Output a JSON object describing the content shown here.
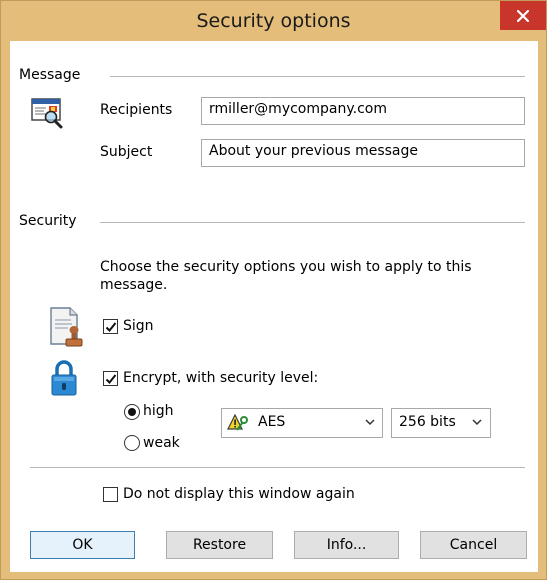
{
  "window": {
    "title": "Security options"
  },
  "message_group": {
    "label": "Message",
    "recipients_label": "Recipients",
    "recipients_value": "rmiller@mycompany.com",
    "subject_label": "Subject",
    "subject_value": "About your previous message"
  },
  "security_group": {
    "label": "Security",
    "description_line1": "Choose the security options you wish to apply to this",
    "description_line2": "message.",
    "sign_label": "Sign",
    "sign_checked": true,
    "encrypt_label": "Encrypt, with security level:",
    "encrypt_checked": true,
    "level_high": "high",
    "level_weak": "weak",
    "selected_level": "high",
    "algorithm_value": "AES",
    "keysize_value": "256 bits"
  },
  "dont_show_label": "Do not display this window again",
  "buttons": {
    "ok": "OK",
    "restore": "Restore",
    "info": "Info...",
    "cancel": "Cancel"
  },
  "colors": {
    "title_bar": "#e4bd7b",
    "close_button": "#c7352b",
    "default_button_border": "#3c7fb1"
  }
}
